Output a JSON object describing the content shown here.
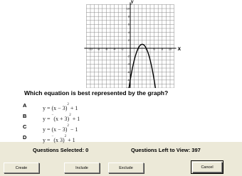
{
  "graph": {
    "y_axis_label": "y",
    "x_axis_label": "x",
    "x_ticks": [
      "-10",
      "-8",
      "-6",
      "-4",
      "-2",
      "2",
      "4",
      "6",
      "8",
      "10"
    ],
    "y_ticks": [
      "10",
      "8",
      "6",
      "4",
      "2",
      "-2",
      "-4",
      "-6",
      "-8",
      "-10"
    ],
    "curve": "y = -(x - 3)^2 + 1"
  },
  "question": "Which equation is best represented by the graph?",
  "choices": [
    {
      "letter": "A",
      "prefix": "y = ",
      "sign": "",
      "inner": "(x − 3)",
      "exp": "2",
      "suffix": " + 1"
    },
    {
      "letter": "B",
      "prefix": "y = ",
      "sign": "−",
      "inner": "(x + 3)",
      "exp": "2",
      "suffix": " + 1"
    },
    {
      "letter": "C",
      "prefix": "y = ",
      "sign": "",
      "inner": "(x − 3)",
      "exp": "2",
      "suffix": " − 1"
    },
    {
      "letter": "D",
      "prefix": "y = ",
      "sign": "−",
      "inner": "(x  3)",
      "exp": "2",
      "suffix": " + 1"
    }
  ],
  "status": {
    "selected": "Questions Selected: 0",
    "left_to_view": "Questions Left to View: 397"
  },
  "buttons": {
    "create": "Create",
    "include": "Include",
    "exclude": "Exclude",
    "cancel": "Cancel"
  },
  "colors": {
    "window_bg": "#ece9d8",
    "panel_bg": "#ffffff",
    "curve": "#000000"
  }
}
